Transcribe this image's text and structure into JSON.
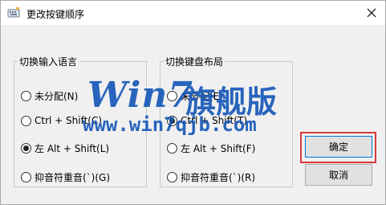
{
  "window": {
    "title": "更改按键顺序",
    "icons": {
      "app": "keyboard-icon",
      "close": "close-icon"
    }
  },
  "input_language_group": {
    "title": "切换输入语言",
    "options": [
      {
        "label": "未分配(N)",
        "checked": false
      },
      {
        "label": "Ctrl + Shift(C)",
        "checked": false
      },
      {
        "label": "左 Alt + Shift(L)",
        "checked": true
      },
      {
        "label": "抑音符重音(`)(G)",
        "checked": false
      }
    ]
  },
  "keyboard_layout_group": {
    "title": "切换键盘布局",
    "options": [
      {
        "label": "未分配(E)",
        "checked": false
      },
      {
        "label": "Ctrl + Shift(T)",
        "checked": true
      },
      {
        "label": "左 Alt + Shift(F)",
        "checked": false
      },
      {
        "label": "抑音符重音(`)(R)",
        "checked": false
      }
    ]
  },
  "buttons": {
    "ok": "确定",
    "cancel": "取消"
  },
  "watermark": {
    "logo": "Win7",
    "brand": "旗舰版",
    "url": "www.win7qjb.com"
  },
  "colors": {
    "highlight": "#d73a3a",
    "watermark": "#1859b8",
    "focus": "#0078d7"
  }
}
